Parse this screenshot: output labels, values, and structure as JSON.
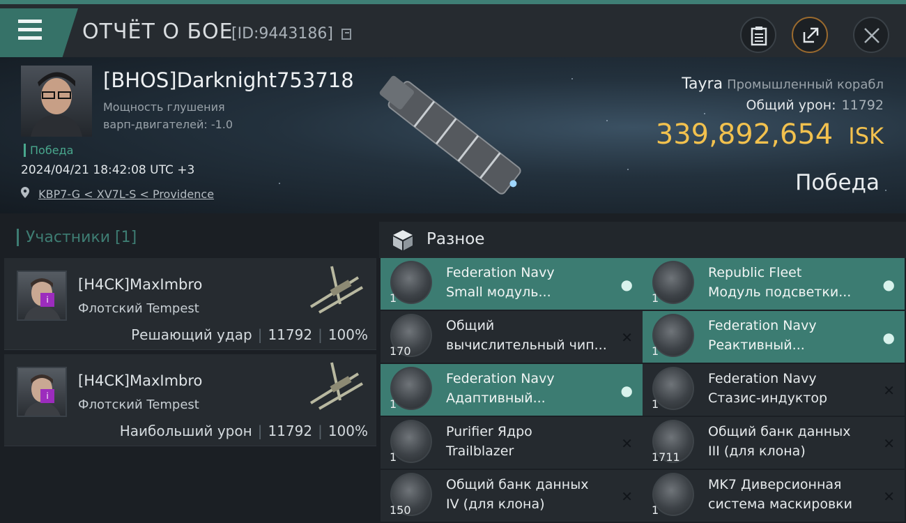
{
  "header": {
    "title": "ОТЧЁТ О БОЕ",
    "report_id": "[ID:9443186]",
    "icons": [
      "menu-icon",
      "copy-icon",
      "clipboard-icon",
      "share-icon",
      "close-icon"
    ]
  },
  "victim": {
    "pilot": "[BHOS]Darknight753718",
    "stat_line1": "Мощность глушения",
    "stat_line2": "варп-двигателей: -1.0",
    "status_small": "Победа",
    "datetime": "2024/04/21 18:42:08 UTC +3",
    "location": "KBP7-G < XV7L-S < Providence",
    "ship": "Tayra",
    "ship_class": "Промышленный корабл",
    "damage_label": "Общий урон:",
    "damage_value": "11792",
    "isk_value": "339,892,654",
    "isk_unit": "ISK",
    "result": "Победа"
  },
  "participants": {
    "header": "Участники [1]",
    "cards": [
      {
        "name": "[H4CK]MaxImbro",
        "ship": "Флотский Tempest",
        "role": "Решающий удар",
        "damage": "11792",
        "percent": "100%"
      },
      {
        "name": "[H4CK]MaxImbro",
        "ship": "Флотский Tempest",
        "role": "Наибольший урон",
        "damage": "11792",
        "percent": "100%"
      }
    ]
  },
  "misc": {
    "header": "Разное",
    "items": [
      {
        "line1": "Federation Navy",
        "line2": "Small модуль...",
        "qty": "1",
        "status": "dropped",
        "highlight": true,
        "icon": "helmet-module-icon"
      },
      {
        "line1": "Republic Fleet",
        "line2": "Модуль подсветки...",
        "qty": "1",
        "status": "dropped",
        "highlight": true,
        "icon": "target-painter-icon"
      },
      {
        "line1": "Общий",
        "line2": "вычислительный чип...",
        "qty": "170",
        "status": "destroyed",
        "highlight": false,
        "icon": "chip-icon"
      },
      {
        "line1": "Federation Navy",
        "line2": "Реактивный...",
        "qty": "1",
        "status": "dropped",
        "highlight": true,
        "icon": "afterburner-icon"
      },
      {
        "line1": "Federation Navy",
        "line2": "Адаптивный...",
        "qty": "1",
        "status": "dropped",
        "highlight": true,
        "icon": "adaptive-module-icon"
      },
      {
        "line1": "Federation Navy",
        "line2": "Стазис-индуктор",
        "qty": "1",
        "status": "destroyed",
        "highlight": false,
        "icon": "stasis-icon"
      },
      {
        "line1": "Purifier Ядро",
        "line2": "Trailblazer",
        "qty": "1",
        "status": "destroyed",
        "highlight": false,
        "icon": "core-icon"
      },
      {
        "line1": "Общий банк данных",
        "line2": "III (для клона)",
        "qty": "1711",
        "status": "destroyed",
        "highlight": false,
        "icon": "databank-icon"
      },
      {
        "line1": "Общий банк данных",
        "line2": "IV (для клона)",
        "qty": "150",
        "status": "destroyed",
        "highlight": false,
        "icon": "databank-icon"
      },
      {
        "line1": "MK7 Диверсионная",
        "line2": "система маскировки",
        "qty": "1",
        "status": "destroyed",
        "highlight": false,
        "icon": "cloak-icon"
      }
    ]
  },
  "colors": {
    "accent": "#3c7c72",
    "isk": "#f2c14e",
    "badge": "#9c2cbd"
  }
}
